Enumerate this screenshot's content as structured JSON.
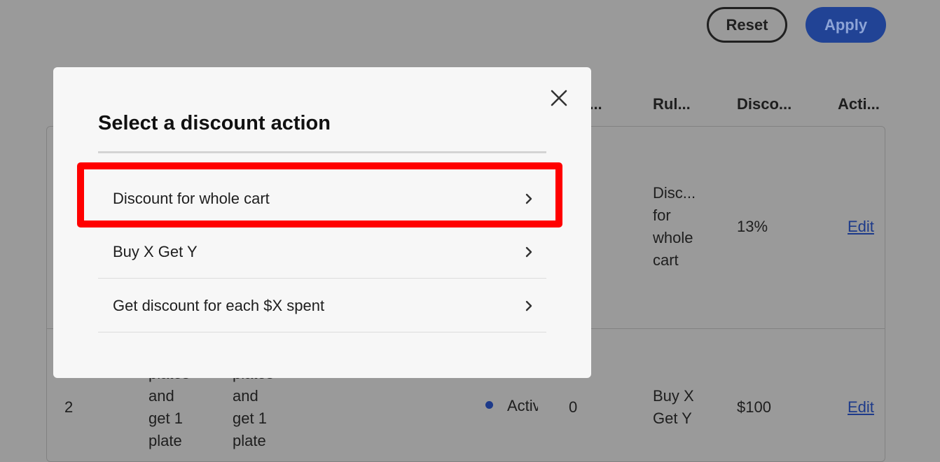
{
  "toolbar": {
    "reset_label": "Reset",
    "apply_label": "Apply"
  },
  "table": {
    "headers": [
      "Co...",
      "Rul...",
      "Disco...",
      "Acti..."
    ],
    "rows": [
      {
        "rule": [
          "Disc...",
          "for",
          "whole",
          "cart"
        ],
        "discount": "13%",
        "action": "Edit"
      },
      {
        "index": "2",
        "name": [
          "plates",
          "and",
          "get 1",
          "plate"
        ],
        "desc": [
          "plates",
          "and",
          "get 1",
          "plate"
        ],
        "status": "Activ",
        "count": "0",
        "rule": [
          "Buy X",
          "Get Y"
        ],
        "discount": "$100",
        "action": "Edit"
      }
    ]
  },
  "modal": {
    "title": "Select a discount action",
    "options": [
      {
        "label": "Discount for whole cart"
      },
      {
        "label": "Buy X Get Y"
      },
      {
        "label": "Get discount for each $X spent"
      }
    ]
  },
  "colors": {
    "highlight": "#ff0000",
    "accent": "#214395",
    "overlay": "#9a9a9a"
  }
}
